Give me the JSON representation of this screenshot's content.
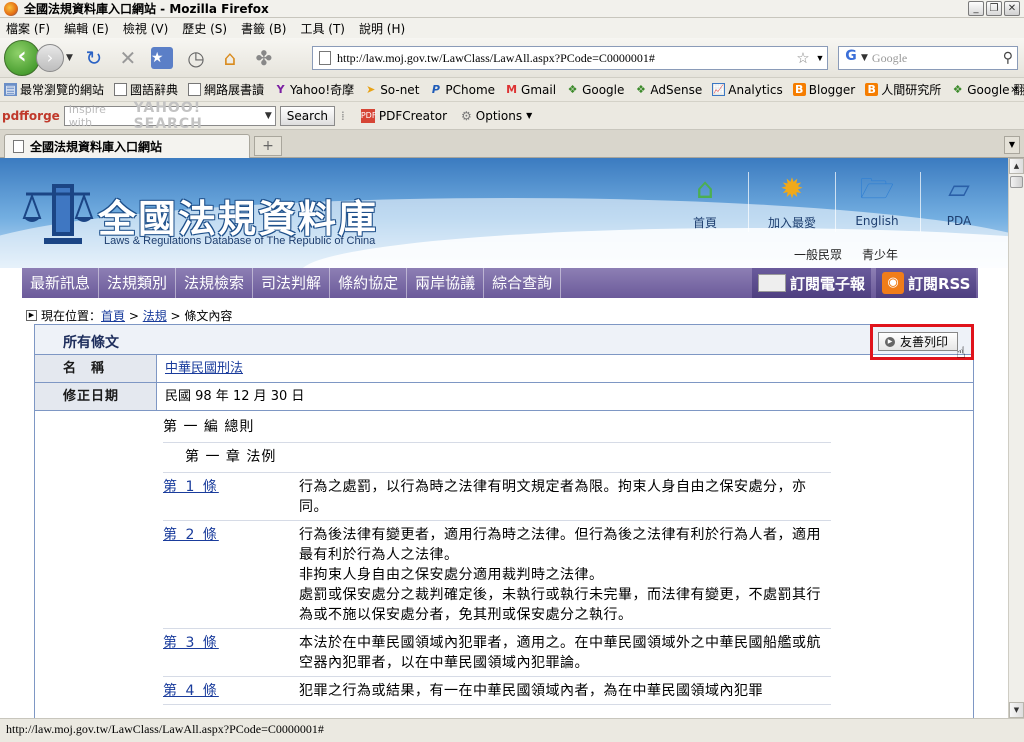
{
  "window": {
    "title": "全國法規資料庫入口網站 - Mozilla Firefox"
  },
  "menubar": {
    "items": [
      "檔案 (F)",
      "編輯 (E)",
      "檢視 (V)",
      "歷史 (S)",
      "書籤 (B)",
      "工具 (T)",
      "說明 (H)"
    ]
  },
  "navbar": {
    "url": "http://law.moj.gov.tw/LawClass/LawAll.aspx?PCode=C0000001#",
    "search_placeholder": "Google"
  },
  "bookmarks": {
    "items": [
      "最常瀏覽的網站",
      "國語辭典",
      "網路展書讀",
      "Yahoo!奇摩",
      "So-net",
      "PChome",
      "Gmail",
      "Google",
      "AdSense",
      "Analytics",
      "Blogger",
      "人間研究所",
      "Google 翻譯"
    ],
    "more": "»"
  },
  "pdfbar": {
    "logo": "pdfforge",
    "search_placeholder": "Inspire with",
    "search_brand": "YAHOO! SEARCH",
    "search_button": "Search",
    "creator": "PDFCreator",
    "options": "Options"
  },
  "tabs": {
    "active": "全國法規資料庫入口網站",
    "new_tab": "+"
  },
  "site": {
    "title": "全國法規資料庫",
    "subtitle": "Laws & Regulations Database of The Republic of China",
    "topnav": [
      "首頁",
      "加入最愛",
      "English",
      "PDA"
    ],
    "audience": [
      "一般民眾",
      "青少年"
    ],
    "mainmenu": [
      "最新訊息",
      "法規類別",
      "法規檢索",
      "司法判解",
      "條約協定",
      "兩岸協議",
      "綜合查詢"
    ],
    "subscribe_epaper": "訂閱電子報",
    "subscribe_rss": "訂閱RSS"
  },
  "breadcrumb": {
    "prefix": "現在位置：",
    "home": "首頁",
    "sep1": " > ",
    "category": "法規",
    "sep2": " > ",
    "current": "條文內容"
  },
  "content": {
    "section_title": "所有條文",
    "print_button": "友善列印",
    "name_label": "名　稱",
    "name_value": "中華民國刑法",
    "date_label": "修正日期",
    "date_value": "民國 98 年 12 月 30 日",
    "part": "第 一 編 總則",
    "chapter": "第 一 章 法例",
    "articles": [
      {
        "num": "第 1 條",
        "lines": [
          "行為之處罰，以行為時之法律有明文規定者為限。拘束人身自由之保安處分，亦同。"
        ]
      },
      {
        "num": "第 2 條",
        "lines": [
          "行為後法律有變更者，適用行為時之法律。但行為後之法律有利於行為人者，適用最有利於行為人之法律。",
          "非拘束人身自由之保安處分適用裁判時之法律。",
          "處罰或保安處分之裁判確定後，未執行或執行未完畢，而法律有變更，不處罰其行為或不施以保安處分者，免其刑或保安處分之執行。"
        ]
      },
      {
        "num": "第 3 條",
        "lines": [
          "本法於在中華民國領域內犯罪者，適用之。在中華民國領域外之中華民國船艦或航空器內犯罪者，以在中華民國領域內犯罪論。"
        ]
      },
      {
        "num": "第 4 條",
        "lines": [
          "犯罪之行為或結果，有一在中華民國領域內者，為在中華民國領域內犯罪"
        ]
      }
    ]
  },
  "statusbar": {
    "text": "http://law.moj.gov.tw/LawClass/LawAll.aspx?PCode=C0000001#"
  }
}
